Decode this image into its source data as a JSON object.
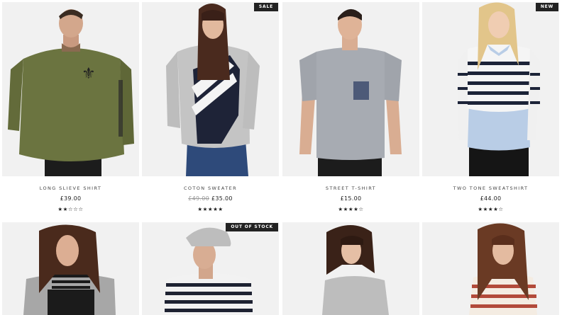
{
  "products": [
    {
      "name": "LONG SLIEVE SHIRT",
      "price": "£39.00",
      "old_price": "",
      "rating": 2,
      "badge": ""
    },
    {
      "name": "COTON SWEATER",
      "price": "£35.00",
      "old_price": "£49.00",
      "rating": 5,
      "badge": "SALE"
    },
    {
      "name": "STREET T-SHIRT",
      "price": "£15.00",
      "old_price": "",
      "rating": 4,
      "badge": ""
    },
    {
      "name": "TWO TONE SWEATSHIRT",
      "price": "£44.00",
      "old_price": "",
      "rating": 4,
      "badge": "NEW"
    },
    {
      "name": "",
      "price": "",
      "old_price": "",
      "rating": 0,
      "badge": ""
    },
    {
      "name": "",
      "price": "",
      "old_price": "",
      "rating": 0,
      "badge": "OUT OF STOCK"
    },
    {
      "name": "",
      "price": "",
      "old_price": "",
      "rating": 0,
      "badge": ""
    },
    {
      "name": "",
      "price": "",
      "old_price": "",
      "rating": 0,
      "badge": ""
    }
  ],
  "star_full": "★",
  "star_empty": "☆",
  "colors": {
    "badge_bg": "#222222",
    "image_bg": "#f1f1f1",
    "text": "#333333",
    "old_price": "#999999"
  }
}
